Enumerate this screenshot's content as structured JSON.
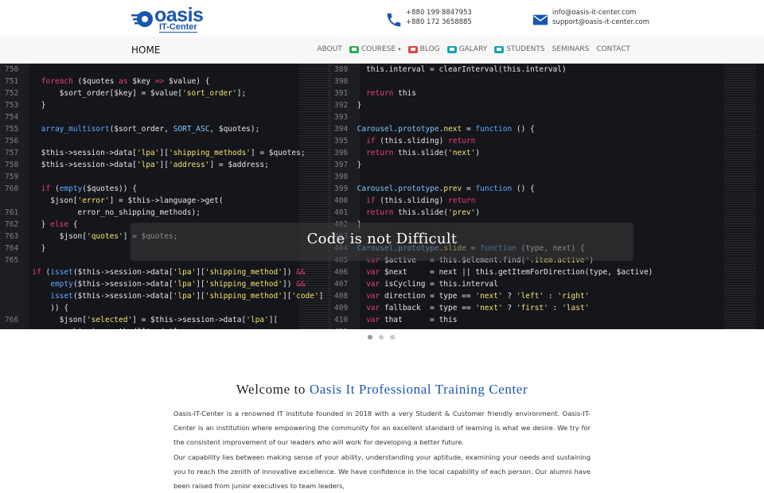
{
  "brand": {
    "name": "oasis",
    "sub": "IT-Center",
    "accent": "#1a56b0"
  },
  "contact": {
    "phones": [
      "+880 199 8847953",
      "+880 172 3658885"
    ],
    "emails": [
      "info@oasis-it-center.com",
      "support@oasis-it-center.com"
    ]
  },
  "nav": {
    "home": "HOME",
    "items": [
      {
        "label": "ABOUT",
        "icon": ""
      },
      {
        "label": "COURESE",
        "icon": "green-badge-icon",
        "color": "#2eae4f",
        "dropdown": true
      },
      {
        "label": "BLOG",
        "icon": "red-badge-icon",
        "color": "#e0453a"
      },
      {
        "label": "GALARY",
        "icon": "teal-badge-icon",
        "color": "#17a2b8"
      },
      {
        "label": "STUDENTS",
        "icon": "teal-badge-icon",
        "color": "#17a2b8"
      },
      {
        "label": "SEMINARS",
        "icon": ""
      },
      {
        "label": "CONTACT",
        "icon": ""
      }
    ]
  },
  "hero": {
    "caption": "Code is not Difficult",
    "slides": 3,
    "active_slide": 1
  },
  "welcome": {
    "title_a": "Welcome to ",
    "title_b": "Oasis It Professional Training Center",
    "para1": "Oasis-IT-Center is a renowned IT institute founded in 2018 with a very Student & Customer friendly environment. Oasis-IT-Center is an institution where empowering the community for an excellent standard of learning is what we desire. We try for the consistent improvement of our leaders who will work for developing a better future.",
    "para2": "Our capability lies between making sense of your ability, understanding your aptitude, examining your needs and sustaining you to reach the zenith of innovative excellence. We have confidence in the local capability of each person. Our alumni have been raised from junior executives to team leaders,"
  }
}
